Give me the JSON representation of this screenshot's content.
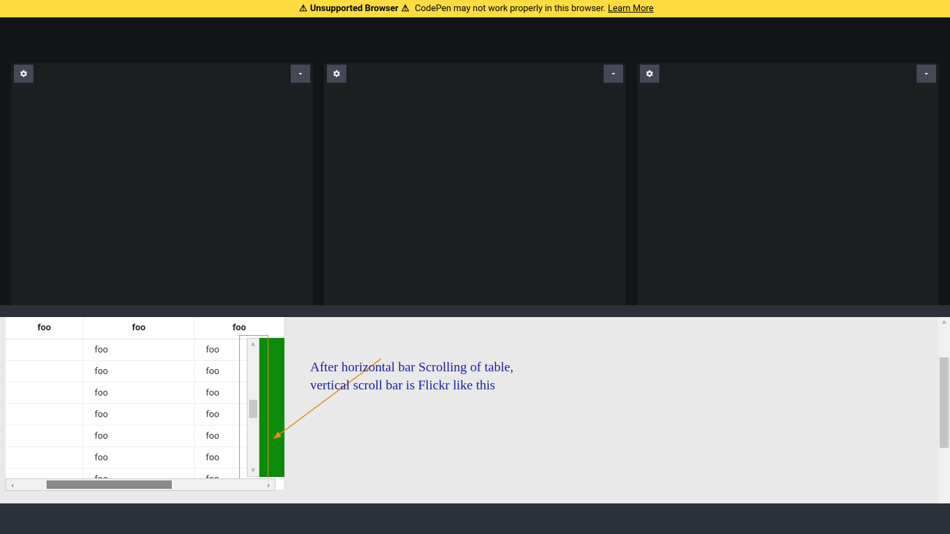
{
  "banner": {
    "title": "Unsupported Browser",
    "message": "CodePen may not work properly in this browser.",
    "link": "Learn More"
  },
  "table": {
    "headers": [
      "foo",
      "foo",
      "foo"
    ],
    "col2": [
      "foo",
      "foo",
      "foo",
      "foo",
      "foo",
      "foo",
      "foo"
    ],
    "col3": [
      "foo",
      "foo",
      "foo",
      "foo",
      "foo",
      "foo",
      "foo"
    ]
  },
  "annotation": {
    "line1": "After horizontal bar Scrolling of table,",
    "line2": "vertical scroll bar is Flickr like this"
  }
}
